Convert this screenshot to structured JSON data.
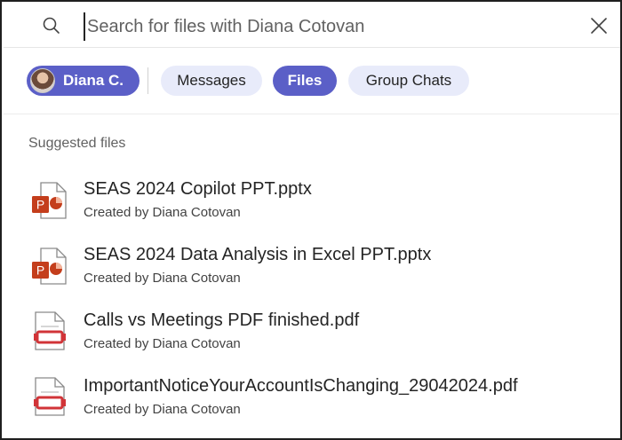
{
  "search": {
    "placeholder": "Search for files with Diana Cotovan",
    "value": ""
  },
  "filters": {
    "person": {
      "label": "Diana C.",
      "selected": true
    },
    "messages": {
      "label": "Messages",
      "selected": false
    },
    "files": {
      "label": "Files",
      "selected": true
    },
    "group_chats": {
      "label": "Group Chats",
      "selected": false
    }
  },
  "section": {
    "label": "Suggested files"
  },
  "files": [
    {
      "name": "SEAS 2024 Copilot PPT.pptx",
      "meta": "Created by Diana Cotovan",
      "icon": "powerpoint-icon"
    },
    {
      "name": "SEAS 2024 Data Analysis in Excel PPT.pptx",
      "meta": "Created by Diana Cotovan",
      "icon": "powerpoint-icon"
    },
    {
      "name": "Calls vs Meetings PDF finished.pdf",
      "meta": "Created by Diana Cotovan",
      "icon": "pdf-icon"
    },
    {
      "name": "ImportantNoticeYourAccountIsChanging_29042024.pdf",
      "meta": "Created by Diana Cotovan",
      "icon": "pdf-icon"
    }
  ],
  "colors": {
    "accent": "#5b5fc7",
    "pill_inactive": "#e8ebfa",
    "powerpoint": "#c43e1c",
    "pdf": "#d13438"
  }
}
